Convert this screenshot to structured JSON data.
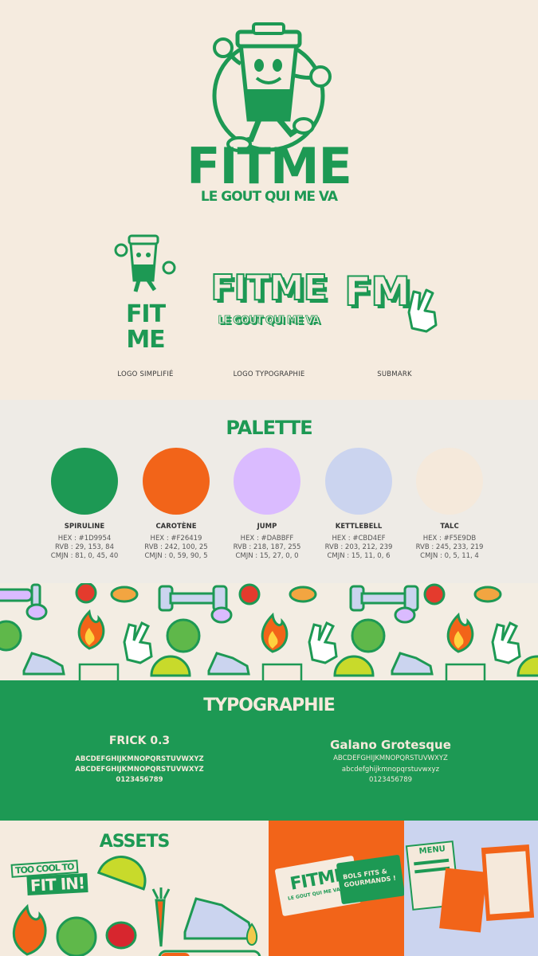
{
  "brand": {
    "name": "FITME",
    "tagline": "LE GOUT QUI ME VA",
    "simplified_line1": "FIT",
    "simplified_line2": "ME",
    "submark": "FM"
  },
  "variants": {
    "items": [
      {
        "label": "LOGO SIMPLIFIÉ"
      },
      {
        "label": "LOGO TYPOGRAPHIE"
      },
      {
        "label": "SUBMARK"
      }
    ]
  },
  "palette": {
    "title": "PALETTE",
    "swatches": [
      {
        "name": "SPIRULINE",
        "hex": "HEX : #1D9954",
        "rvb": "RVB : 29, 153, 84",
        "cmjn": "CMJN : 81, 0, 45, 40",
        "color": "#1D9954"
      },
      {
        "name": "CAROTÈNE",
        "hex": "HEX : #F26419",
        "rvb": "RVB : 242, 100, 25",
        "cmjn": "CMJN : 0, 59, 90, 5",
        "color": "#F26419"
      },
      {
        "name": "JUMP",
        "hex": "HEX : #DABBFF",
        "rvb": "RVB : 218, 187, 255",
        "cmjn": "CMJN : 15, 27, 0, 0",
        "color": "#DABBFF"
      },
      {
        "name": "KETTLEBELL",
        "hex": "HEX : #CBD4EF",
        "rvb": "RVB : 203, 212, 239",
        "cmjn": "CMJN : 15, 11, 0, 6",
        "color": "#CBD4EF"
      },
      {
        "name": "TALC",
        "hex": "HEX : #F5E9DB",
        "rvb": "RVB : 245, 233, 219",
        "cmjn": "CMJN : 0, 5, 11, 4",
        "color": "#F5E9DB"
      }
    ]
  },
  "typography": {
    "title": "TYPOGRAPHIE",
    "font1": {
      "name": "FRICK 0.3",
      "upper": "ABCDEFGHIJKMNOPQRSTUVWXYZ",
      "upper2": "ABCDEFGHIJKMNOPQRSTUVWXYZ",
      "digits": "0123456789"
    },
    "font2": {
      "name": "Galano Grotesque",
      "upper": "ABCDEFGHIJKMNOPQRSTUVWXYZ",
      "lower": "abcdefghijkmnopqrstuvwxyz",
      "digits": "0123456789"
    }
  },
  "assets": {
    "title": "ASSETS",
    "sticker_top": "TOO COOL TO",
    "sticker_bottom": "FIT IN!",
    "card_text": "BOLS FITS & GOURMANDS !",
    "menu_title": "MENU"
  },
  "colors": {
    "green": "#1D9954",
    "orange": "#F26419",
    "lilac": "#DABBFF",
    "blue": "#CBD4EF",
    "cream": "#F5E9DB"
  }
}
